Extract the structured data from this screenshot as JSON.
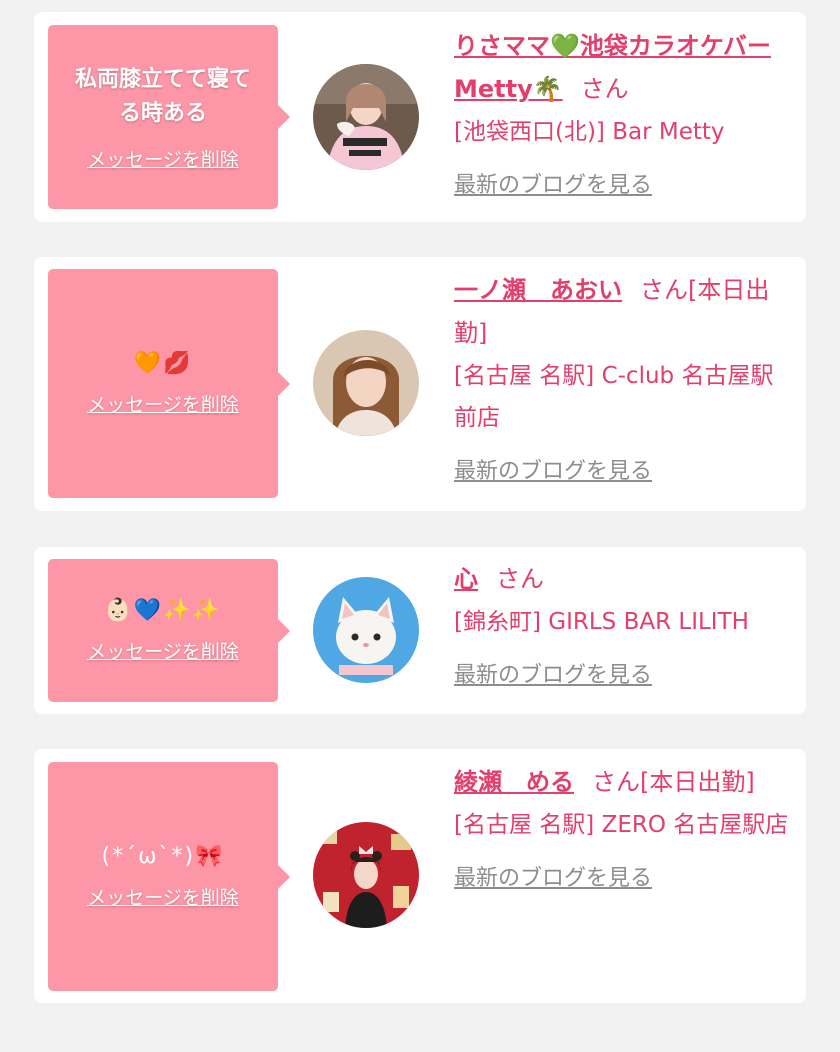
{
  "colors": {
    "background": "#f2f2f2",
    "card": "#ffffff",
    "bubble": "#fd97a7",
    "accent": "#e23f6c",
    "link_gray": "#8d8d8d"
  },
  "entries": [
    {
      "message_lines": [
        "私両膝立てて寝て",
        "る時ある"
      ],
      "delete_label": "メッセージを削除",
      "avatar": "woman-in-jersey-photo",
      "name": "りさママ💚池袋カラオケバーMetty🌴",
      "honorific": "さん",
      "shop": "[池袋西口(北)] Bar Metty",
      "blog_link": "最新のブログを見る"
    },
    {
      "message_emoji": "🧡💋",
      "delete_label": "メッセージを削除",
      "avatar": "woman-portrait-photo",
      "name": "一ノ瀬　あおい",
      "honorific": "さん[本日出勤]",
      "shop": "[名古屋 名駅] C-club 名古屋駅前店",
      "blog_link": "最新のブログを見る"
    },
    {
      "message_emoji": "👶🏻💙✨✨",
      "delete_label": "メッセージを削除",
      "avatar": "white-kitten-figure-photo",
      "name": "心",
      "honorific": "さん",
      "shop": "[錦糸町] GIRLS BAR LILITH",
      "blog_link": "最新のブログを見る"
    },
    {
      "message_emoji": "(*´ω`*)🎀",
      "delete_label": "メッセージを削除",
      "avatar": "woman-red-background-photo",
      "name": "綾瀬　める",
      "honorific": "さん[本日出勤]",
      "shop": "[名古屋 名駅] ZERO 名古屋駅店",
      "blog_link": "最新のブログを見る"
    }
  ]
}
